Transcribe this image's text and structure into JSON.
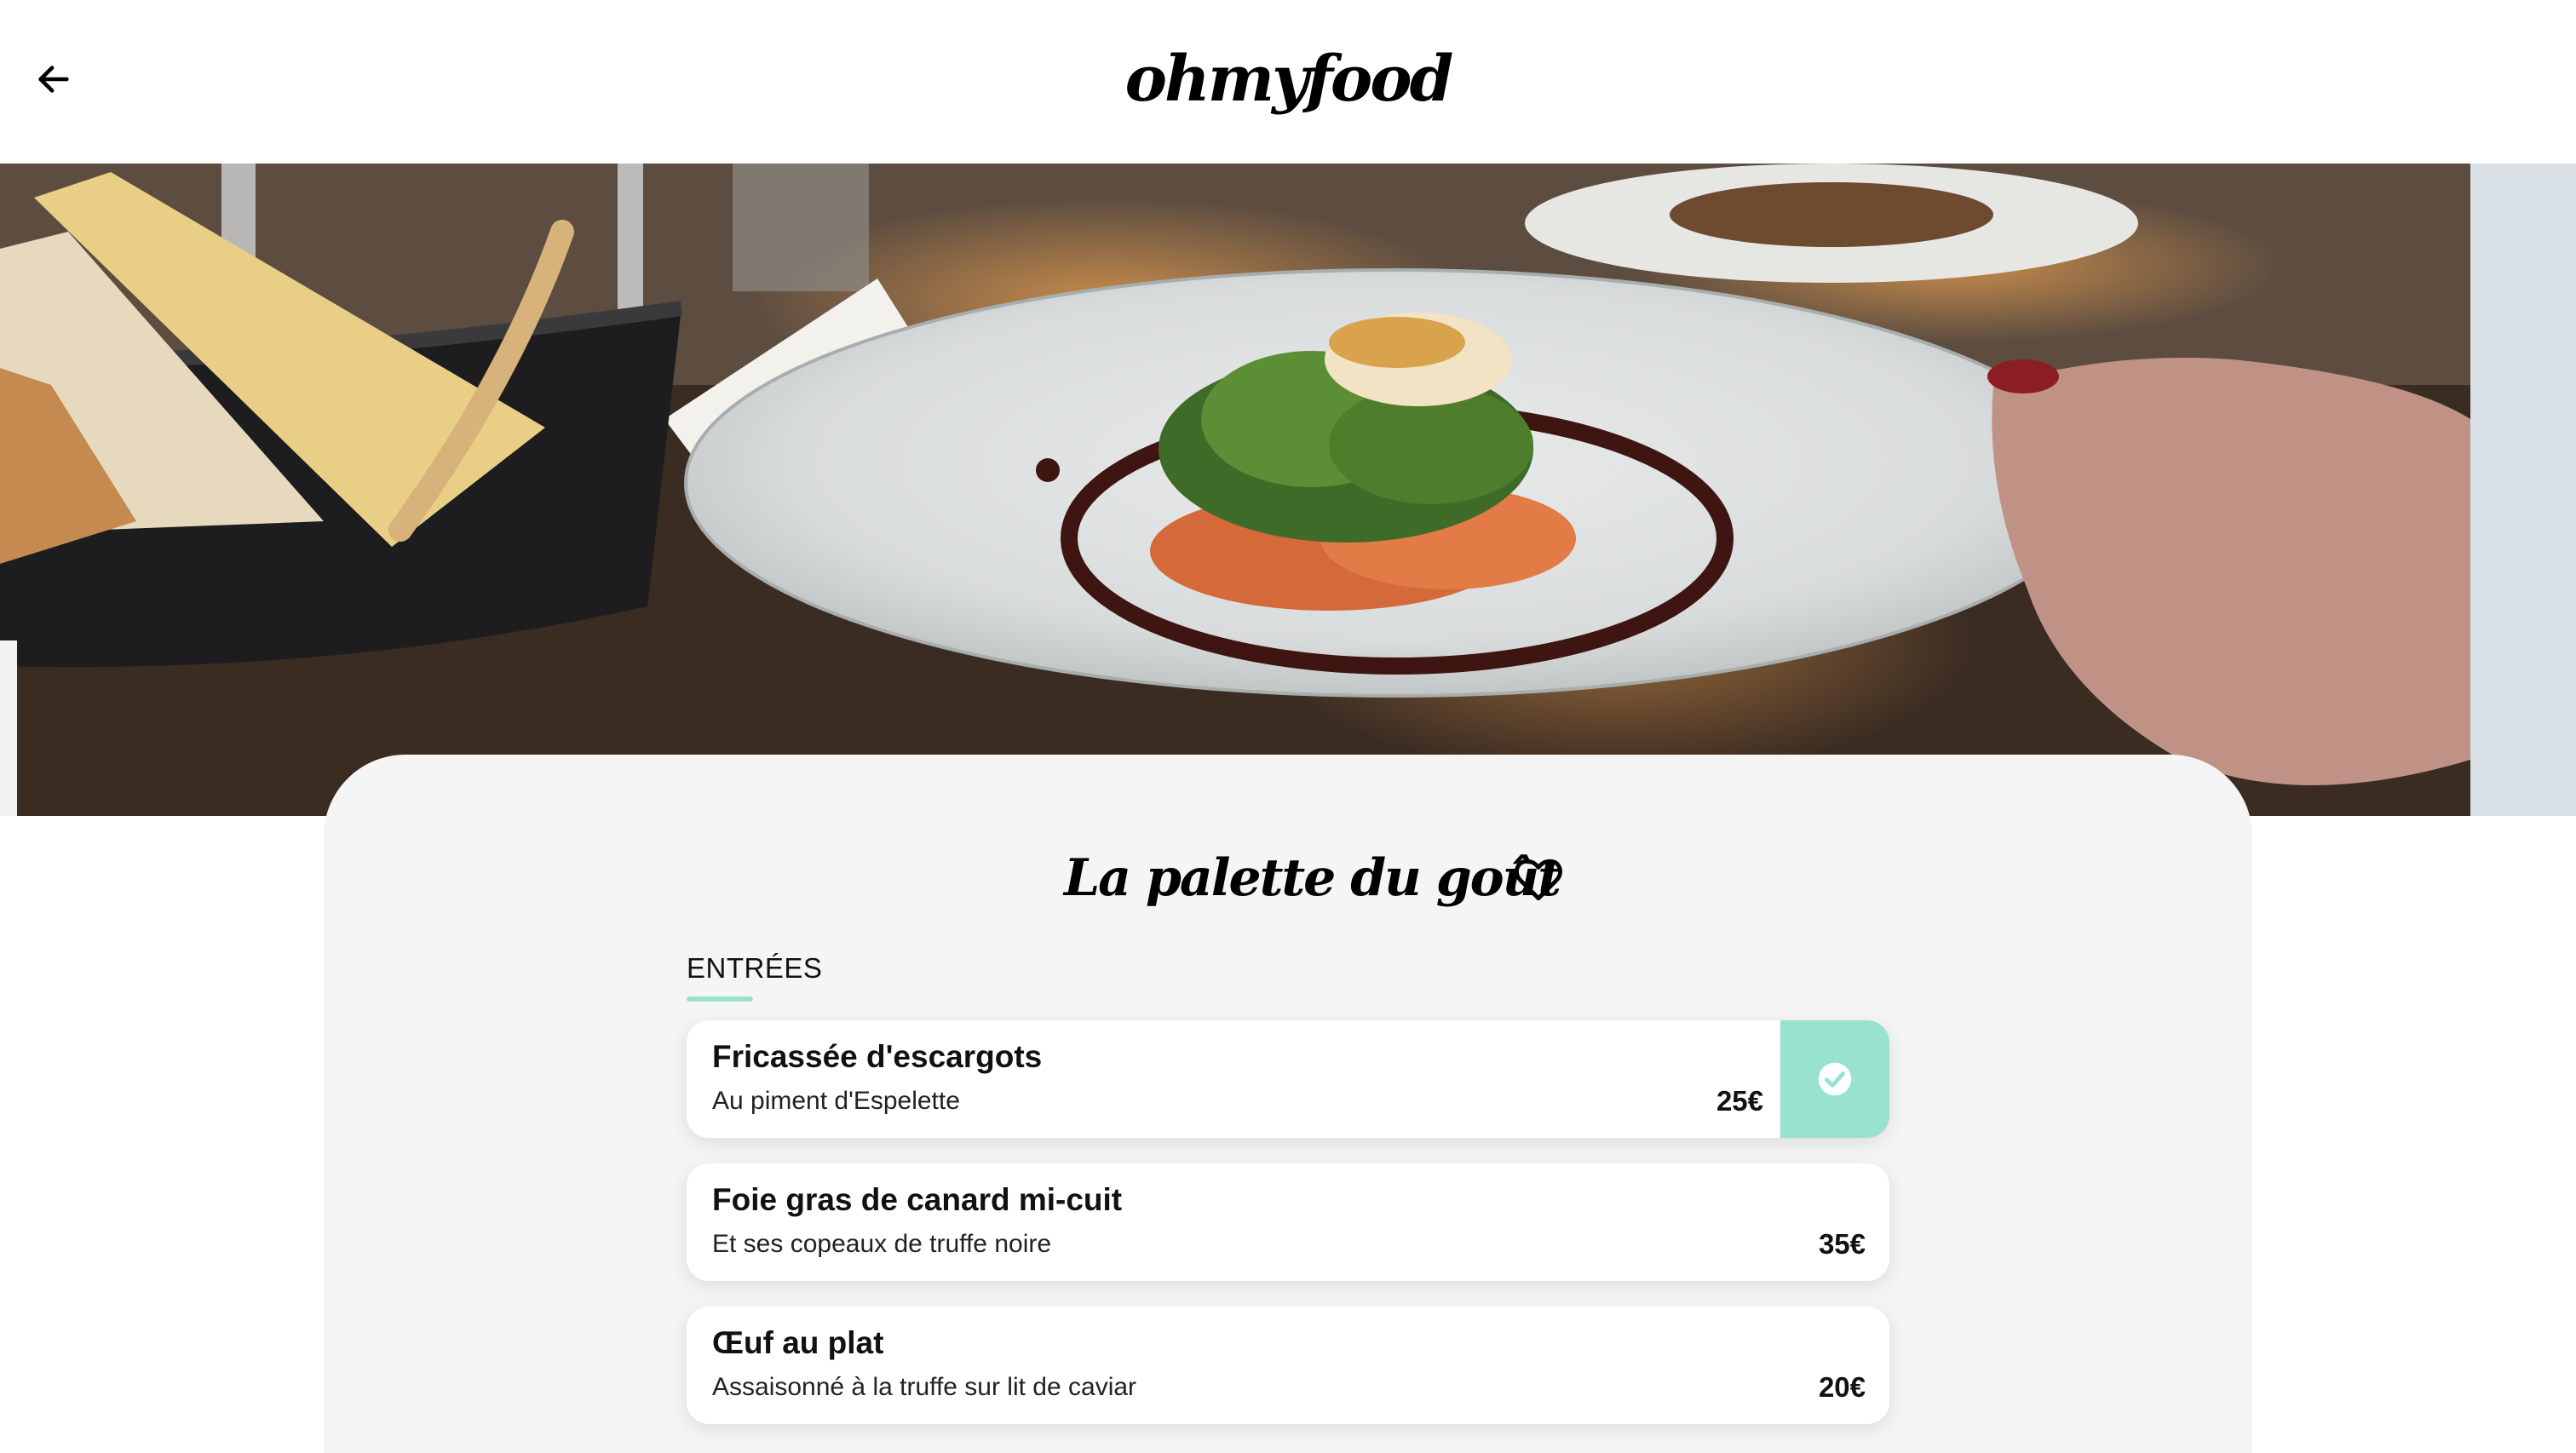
{
  "header": {
    "back_icon": "arrow-left-icon",
    "logo": "ohmyfood"
  },
  "hero": {
    "image": "plated-dish-photo"
  },
  "restaurant": {
    "name": "La palette du goût",
    "favorite_icon": "heart-outline-icon"
  },
  "menu": {
    "section_label": "ENTRÉES",
    "items": [
      {
        "name": "Fricassée d'escargots",
        "description": "Au piment d'Espelette",
        "price": "25€",
        "selected": true
      },
      {
        "name": "Foie gras de canard mi-cuit",
        "description": "Et ses copeaux de truffe noire",
        "price": "35€",
        "selected": false
      },
      {
        "name": "Œuf au plat",
        "description": "Assaisonné à la truffe sur lit de caviar",
        "price": "20€",
        "selected": false
      }
    ]
  },
  "colors": {
    "accent": "#99e2d0",
    "card_background": "#f5f5f5",
    "text": "#000000"
  }
}
